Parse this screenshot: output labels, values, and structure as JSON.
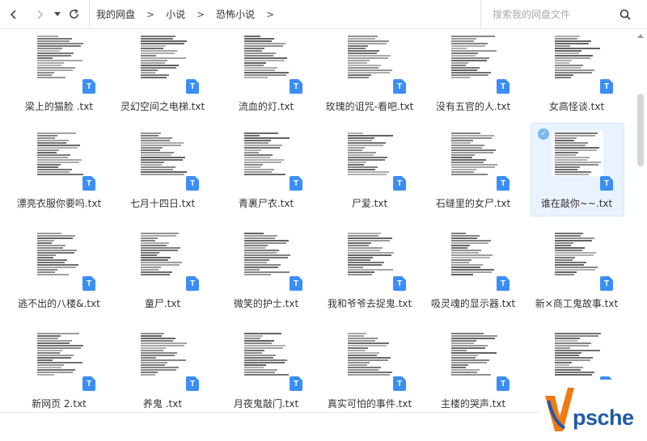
{
  "toolbar": {
    "back_icon": "chevron-left-icon",
    "forward_icon": "chevron-right-icon",
    "dropdown_icon": "caret-down-icon",
    "refresh_icon": "refresh-icon",
    "breadcrumb": [
      "我的网盘",
      "小说",
      "恐怖小说"
    ],
    "separator": ">"
  },
  "search": {
    "placeholder": "搜索我的网盘文件",
    "icon": "search-icon"
  },
  "files": [
    {
      "name": "梁上的猫脸 .txt",
      "type": "T",
      "selected": false
    },
    {
      "name": "灵幻空间之电梯.txt",
      "type": "T",
      "selected": false
    },
    {
      "name": "流血的灯.txt",
      "type": "T",
      "selected": false
    },
    {
      "name": "玫瑰的诅咒-看吧.txt",
      "type": "T",
      "selected": false
    },
    {
      "name": "没有五官的人.txt",
      "type": "T",
      "selected": false
    },
    {
      "name": "女高怪谈.txt",
      "type": "T",
      "selected": false
    },
    {
      "name": "漂亮衣服你要吗.txt",
      "type": "T",
      "selected": false
    },
    {
      "name": "七月十四日.txt",
      "type": "T",
      "selected": false
    },
    {
      "name": "青裹尸衣.txt",
      "type": "T",
      "selected": false
    },
    {
      "name": "尸爱.txt",
      "type": "T",
      "selected": false
    },
    {
      "name": "石缝里的女尸.txt",
      "type": "T",
      "selected": false
    },
    {
      "name": "谁在敲你~~.txt",
      "type": "T",
      "selected": true
    },
    {
      "name": "逃不出的八楼&.txt",
      "type": "T",
      "selected": false
    },
    {
      "name": "童尸.txt",
      "type": "T",
      "selected": false
    },
    {
      "name": "微笑的护士.txt",
      "type": "T",
      "selected": false
    },
    {
      "name": "我和爷爷去捉鬼.txt",
      "type": "T",
      "selected": false
    },
    {
      "name": "吸灵魂的显示器.txt",
      "type": "T",
      "selected": false
    },
    {
      "name": "新×商工鬼故事.txt",
      "type": "T",
      "selected": false
    },
    {
      "name": "新网页 2.txt",
      "type": "T",
      "selected": false
    },
    {
      "name": "养鬼 .txt",
      "type": "T",
      "selected": false
    },
    {
      "name": "月夜鬼敲门.txt",
      "type": "T",
      "selected": false
    },
    {
      "name": "真实可怕的事件.txt",
      "type": "T",
      "selected": false
    },
    {
      "name": "主楼的哭声.txt",
      "type": "T",
      "selected": false
    },
    {
      "name": "",
      "type": "T",
      "selected": false
    }
  ],
  "watermark": {
    "text": "psche",
    "logo_icon": "v-logo-icon"
  },
  "colors": {
    "accent": "#3a8ef6",
    "selected_bg": "#e9f3ff",
    "watermark": "#1e5aa8"
  }
}
